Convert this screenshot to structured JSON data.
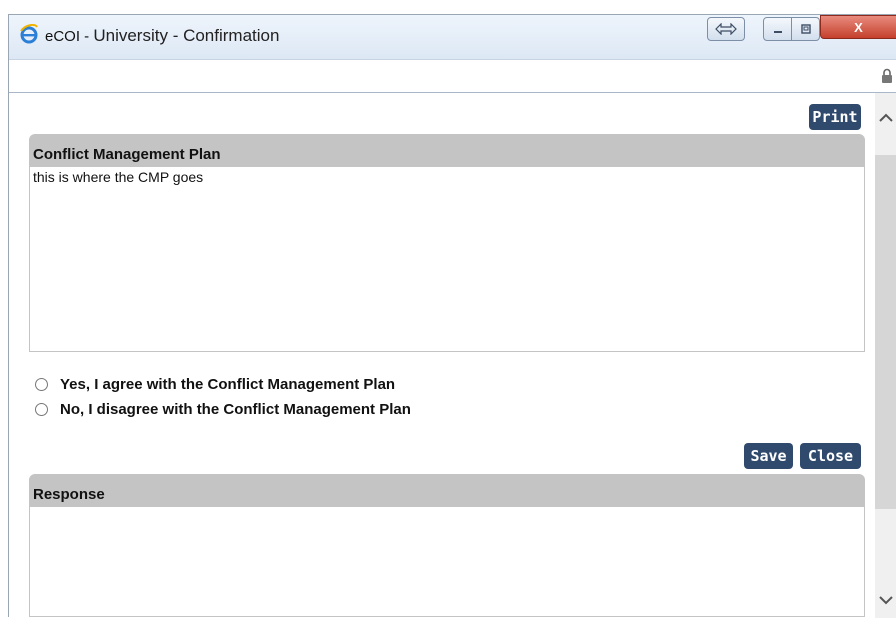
{
  "window": {
    "app_name": "eCOI - ",
    "title": "University - Confirmation",
    "close_glyph": "X"
  },
  "address_bar": {
    "url": ""
  },
  "toolbar": {
    "print_label": "Print"
  },
  "cmp_panel": {
    "heading": "Conflict Management Plan",
    "body": "this is where the CMP goes"
  },
  "options": [
    {
      "label": "Yes, I agree with the Conflict Management Plan",
      "checked": false
    },
    {
      "label": "No, I disagree with the Conflict Management Plan",
      "checked": false
    }
  ],
  "actions": {
    "save_label": "Save",
    "close_label": "Close"
  },
  "response_panel": {
    "heading": "Response",
    "value": ""
  },
  "colors": {
    "button_bg": "#2f4a6c",
    "panel_header_bg": "#c4c4c4",
    "close_button_red": "#c5402d"
  },
  "icons": [
    "ie-logo-icon",
    "resize-arrows-icon",
    "minimize-icon",
    "maximize-icon",
    "close-icon",
    "lock-icon",
    "chevron-up-icon",
    "chevron-down-icon"
  ]
}
